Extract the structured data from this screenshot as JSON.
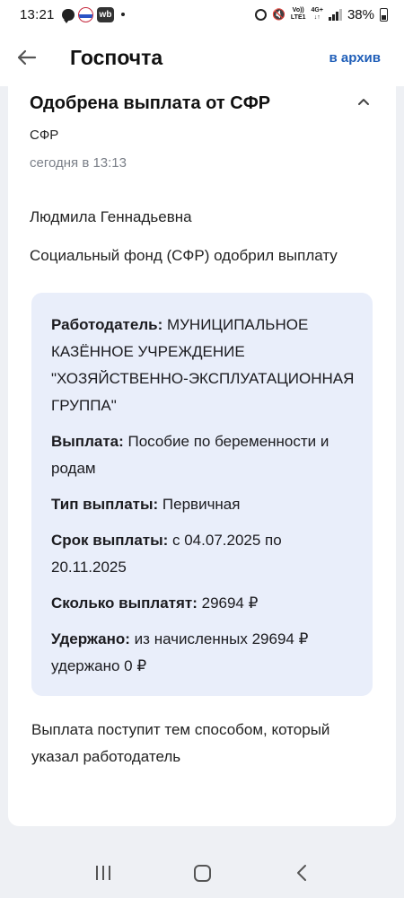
{
  "status_bar": {
    "time": "13:21",
    "network_top": "Vo))",
    "network_bottom": "LTE1",
    "network2_top": "4G+",
    "network2_bottom": "↓↑",
    "battery": "38%",
    "wb_badge": "wb"
  },
  "header": {
    "title": "Госпочта",
    "archive_label": "в архив"
  },
  "message": {
    "title": "Одобрена выплата от СФР",
    "sender": "СФР",
    "date": "сегодня в 13:13",
    "greeting": "Людмила Геннадьевна",
    "body": "Социальный фонд (СФР) одобрил выплату",
    "details": [
      {
        "label": "Работодатель:",
        "value": " МУНИЦИПАЛЬНОЕ КАЗЁННОЕ УЧРЕЖДЕНИЕ \"ХОЗЯЙСТВЕННО-ЭКСПЛУАТАЦИОННАЯ ГРУППА\""
      },
      {
        "label": "Выплата:",
        "value": " Пособие по беременности и родам"
      },
      {
        "label": "Тип выплаты:",
        "value": " Первичная"
      },
      {
        "label": "Срок выплаты:",
        "value": " с 04.07.2025 по 20.11.2025"
      },
      {
        "label": "Сколько выплатят:",
        "value": " 29694 ₽"
      },
      {
        "label": "Удержано:",
        "value": " из начисленных 29694 ₽ удержано 0 ₽"
      }
    ],
    "footer": "Выплата поступит тем способом, который указал работодатель"
  },
  "colors": {
    "accent": "#1f5eb8",
    "info_bg": "#e9eefa",
    "page_bg": "#eef0f4"
  }
}
